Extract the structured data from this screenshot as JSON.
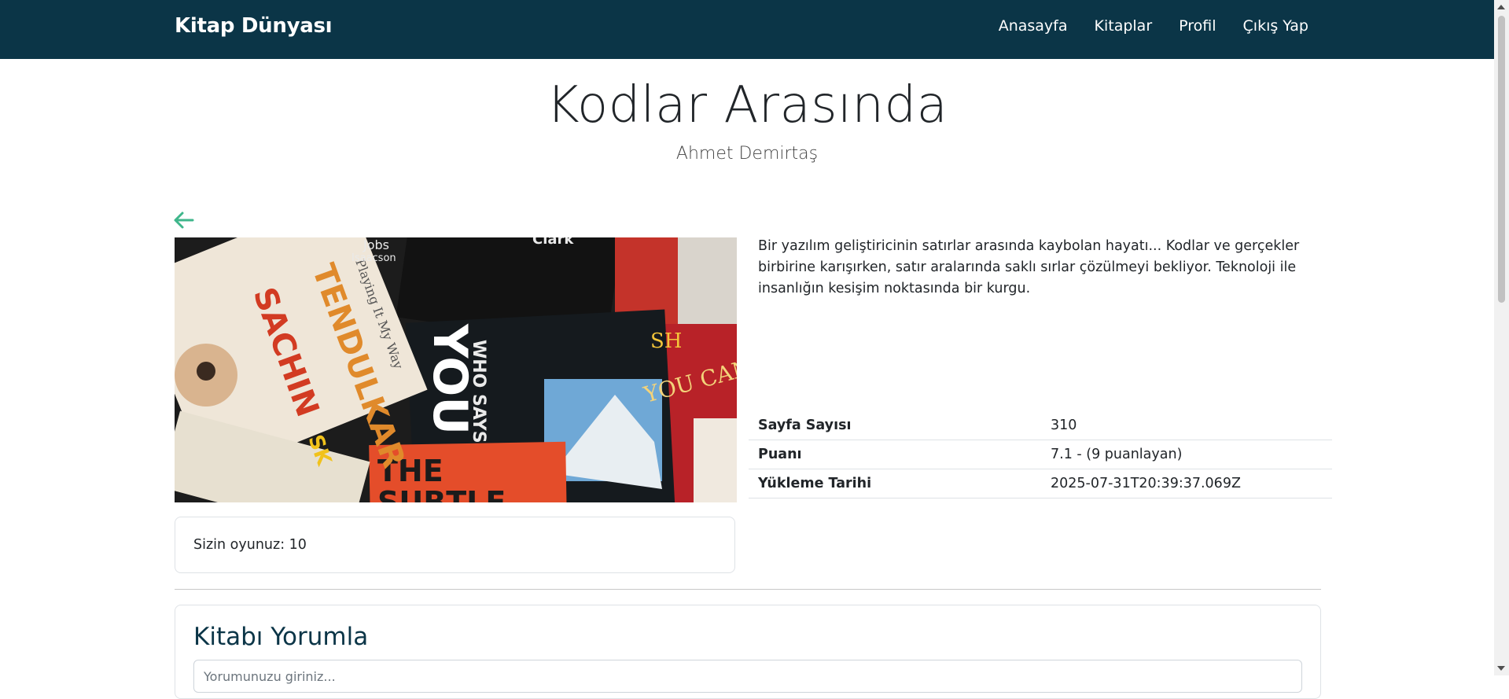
{
  "navbar": {
    "brand": "Kitap Dünyası",
    "links": [
      "Anasayfa",
      "Kitaplar",
      "Profil",
      "Çıkış Yap"
    ]
  },
  "book": {
    "title": "Kodlar Arasında",
    "author": "Ahmet Demirtaş",
    "description": "Bir yazılım geliştiricinin satırlar arasında kaybolan hayatı... Kodlar ve gerçekler birbirine karışırken, satır aralarında saklı sırlar çözülmeyi bekliyor. Teknoloji ile insanlığın kesişim noktasında bir kurgu.",
    "details": [
      {
        "label": "Sayfa Sayısı",
        "value": "310"
      },
      {
        "label": "Puanı",
        "value": "7.1 - (9 puanlayan)"
      },
      {
        "label": "Yükleme Tarihi",
        "value": "2025-07-31T20:39:37.069Z"
      }
    ],
    "cover_texts": [
      "SACHIN TENDULKAR",
      "Playing It My Way",
      "WHO SAYS YOU CAN'T? YOU DO",
      "THE SUBTLE",
      "YOU CAN",
      "Jobs Isaacson",
      "Clark"
    ]
  },
  "rating": {
    "text": "Sizin oyunuz: 10"
  },
  "comment": {
    "title": "Kitabı Yorumla",
    "placeholder": "Yorumunuzu giriniz..."
  },
  "colors": {
    "navbar": "#0b3547",
    "accent": "#3fb68b",
    "heading": "#0b3547"
  },
  "icons": {
    "back": "arrow-left-icon"
  }
}
